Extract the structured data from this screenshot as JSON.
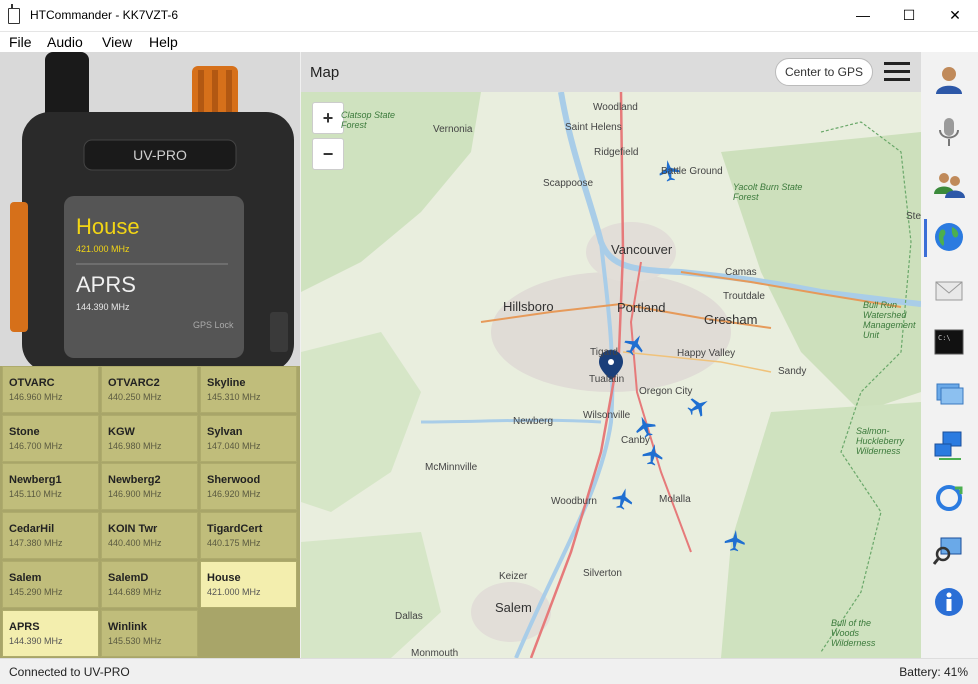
{
  "window": {
    "title": "HTCommander - KK7VZT-6"
  },
  "menu": [
    "File",
    "Audio",
    "View",
    "Help"
  ],
  "radio": {
    "model": "UV-PRO",
    "vfo_a": {
      "name": "House",
      "freq": "421.000 MHz"
    },
    "vfo_b": {
      "name": "APRS",
      "freq": "144.390 MHz"
    },
    "gps_status": "GPS Lock"
  },
  "channels": [
    {
      "name": "OTVARC",
      "freq": "146.960 MHz"
    },
    {
      "name": "OTVARC2",
      "freq": "440.250 MHz"
    },
    {
      "name": "Skyline",
      "freq": "145.310 MHz"
    },
    {
      "name": "Stone",
      "freq": "146.700 MHz"
    },
    {
      "name": "KGW",
      "freq": "146.980 MHz"
    },
    {
      "name": "Sylvan",
      "freq": "147.040 MHz"
    },
    {
      "name": "Newberg1",
      "freq": "145.110 MHz"
    },
    {
      "name": "Newberg2",
      "freq": "146.900 MHz"
    },
    {
      "name": "Sherwood",
      "freq": "146.920 MHz"
    },
    {
      "name": "CedarHil",
      "freq": "147.380 MHz"
    },
    {
      "name": "KOIN Twr",
      "freq": "440.400 MHz"
    },
    {
      "name": "TigardCert",
      "freq": "440.175 MHz"
    },
    {
      "name": "Salem",
      "freq": "145.290 MHz"
    },
    {
      "name": "SalemD",
      "freq": "144.689 MHz"
    },
    {
      "name": "House",
      "freq": "421.000 MHz"
    },
    {
      "name": "APRS",
      "freq": "144.390 MHz"
    },
    {
      "name": "Winlink",
      "freq": "145.530 MHz"
    }
  ],
  "map": {
    "title": "Map",
    "center_button": "Center to GPS",
    "zoom_in": "+",
    "zoom_out": "−",
    "labels": {
      "woodland": "Woodland",
      "vernonia": "Vernonia",
      "st_helens": "Saint Helens",
      "ridgefield": "Ridgefield",
      "battle_ground": "Battle Ground",
      "scappoose": "Scappoose",
      "vancouver": "Vancouver",
      "camas": "Camas",
      "troutdale": "Troutdale",
      "hillsboro": "Hillsboro",
      "portland": "Portland",
      "gresham": "Gresham",
      "tigard": "Tigard",
      "tualatin": "Tualatin",
      "happy_valley": "Happy Valley",
      "sandy": "Sandy",
      "oregon_city": "Oregon City",
      "wilsonville": "Wilsonville",
      "newberg": "Newberg",
      "canby": "Canby",
      "mcminnville": "McMinnville",
      "woodburn": "Woodburn",
      "molalla": "Molalla",
      "keizer": "Keizer",
      "silverton": "Silverton",
      "salem": "Salem",
      "dallas": "Dallas",
      "monmouth": "Monmouth",
      "st": "Ste",
      "clatsop": "Clatsop State Forest",
      "yacolt": "Yacolt Burn State Forest",
      "bull_run": "Bull Run Watershed Management Unit",
      "salmon": "Salmon-Huckleberry Wilderness",
      "bull_woods": "Bull of the Woods Wilderness"
    }
  },
  "status": {
    "left": "Connected to UV-PRO",
    "right": "Battery: 41%"
  },
  "colors": {
    "channel_bg": "#c0bd7b",
    "channel_active": "#f3eeae",
    "vfo_a_text": "#f2d515",
    "plane_blue": "#1f6fd1"
  }
}
